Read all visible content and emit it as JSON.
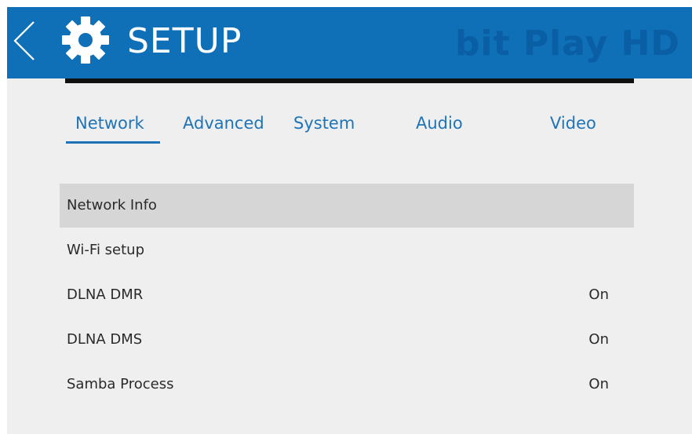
{
  "header": {
    "back_icon": "chevron-left-icon",
    "settings_icon": "gear-icon",
    "title": "SETUP",
    "brand": "bit Play HD"
  },
  "colors": {
    "header_bg": "#0f6fb7",
    "brand_text": "#0a5ea3",
    "tab_text": "#1f74b8",
    "panel_bg": "#efefef",
    "selected_row_bg": "#d6d6d6"
  },
  "tabs": [
    {
      "label": "Network",
      "active": true
    },
    {
      "label": "Advanced",
      "active": false
    },
    {
      "label": "System",
      "active": false
    },
    {
      "label": "Audio",
      "active": false
    },
    {
      "label": "Video",
      "active": false
    }
  ],
  "menu": {
    "items": [
      {
        "label": "Network Info",
        "value": "",
        "selected": true
      },
      {
        "label": "Wi-Fi setup",
        "value": "",
        "selected": false
      },
      {
        "label": "DLNA DMR",
        "value": "On",
        "selected": false
      },
      {
        "label": "DLNA DMS",
        "value": "On",
        "selected": false
      },
      {
        "label": "Samba Process",
        "value": "On",
        "selected": false
      }
    ]
  }
}
